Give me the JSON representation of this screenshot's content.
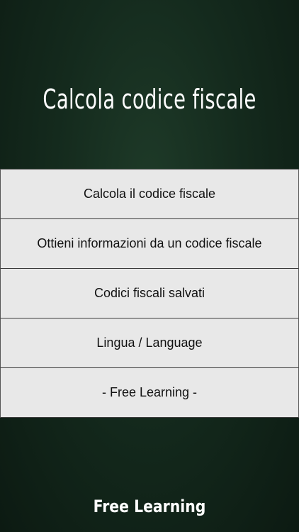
{
  "app": {
    "title": "Calcola codice fiscale"
  },
  "menu": {
    "items": [
      {
        "label": "Calcola il codice fiscale"
      },
      {
        "label": "Ottieni informazioni da un codice fiscale"
      },
      {
        "label": "Codici fiscali salvati"
      },
      {
        "label": "Lingua / Language"
      },
      {
        "label": "- Free Learning -"
      }
    ]
  },
  "footer": {
    "logo_text": "Free Learning"
  },
  "colors": {
    "background": "#142a1d",
    "menu_item_bg": "#e8e8e8",
    "text_dark": "#111111",
    "text_light": "#ffffff"
  }
}
